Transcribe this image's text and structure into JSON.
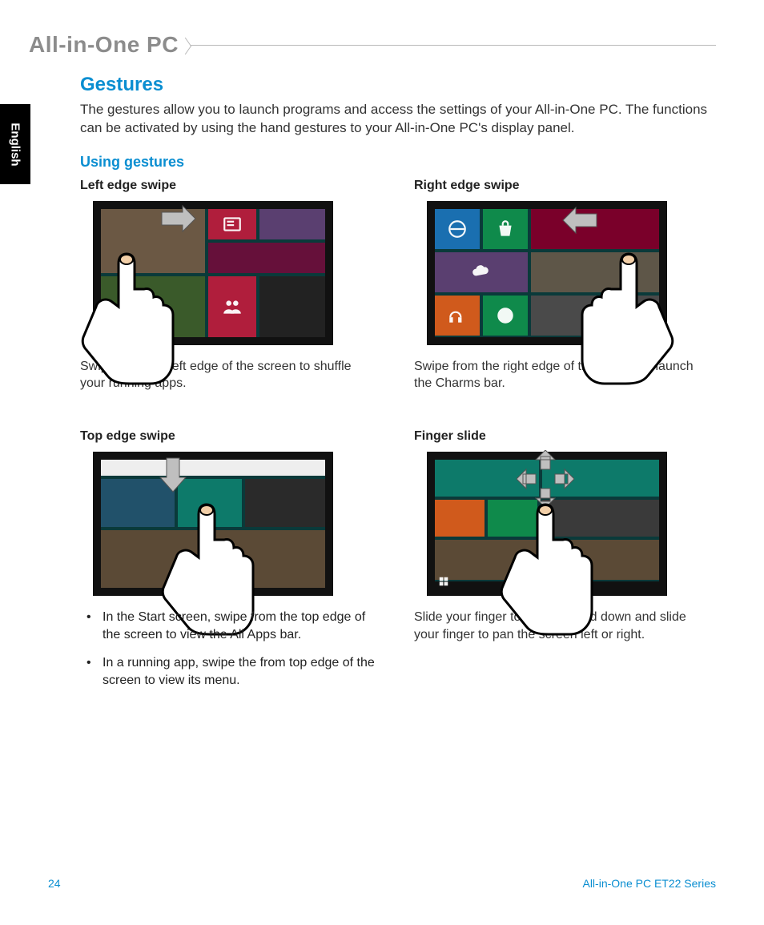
{
  "header": {
    "product": "All-in-One PC"
  },
  "lang_tab": "English",
  "section": {
    "title": "Gestures",
    "intro": "The gestures allow you to launch programs and access the settings of your All-in-One PC. The functions can be activated by using the hand gestures to your All-in-One PC's display panel.",
    "subtitle": "Using gestures"
  },
  "gestures": {
    "left": {
      "title": "Left edge swipe",
      "desc": "Swipe from the left edge of the screen to shuffle your running apps."
    },
    "right": {
      "title": "Right edge swipe",
      "desc": "Swipe from the right edge of the screen to launch the Charms bar."
    },
    "top": {
      "title": "Top edge swipe",
      "b1": "In the Start screen, swipe from the top edge of the screen to view the All Apps bar.",
      "b2": "In a running app, swipe the from top edge of the screen to view its menu."
    },
    "slide": {
      "title": "Finger slide",
      "desc": "Slide your finger to scroll up and down and slide your finger to pan the screen left or right."
    }
  },
  "footer": {
    "page": "24",
    "series": "All-in-One PC ET22 Series"
  }
}
